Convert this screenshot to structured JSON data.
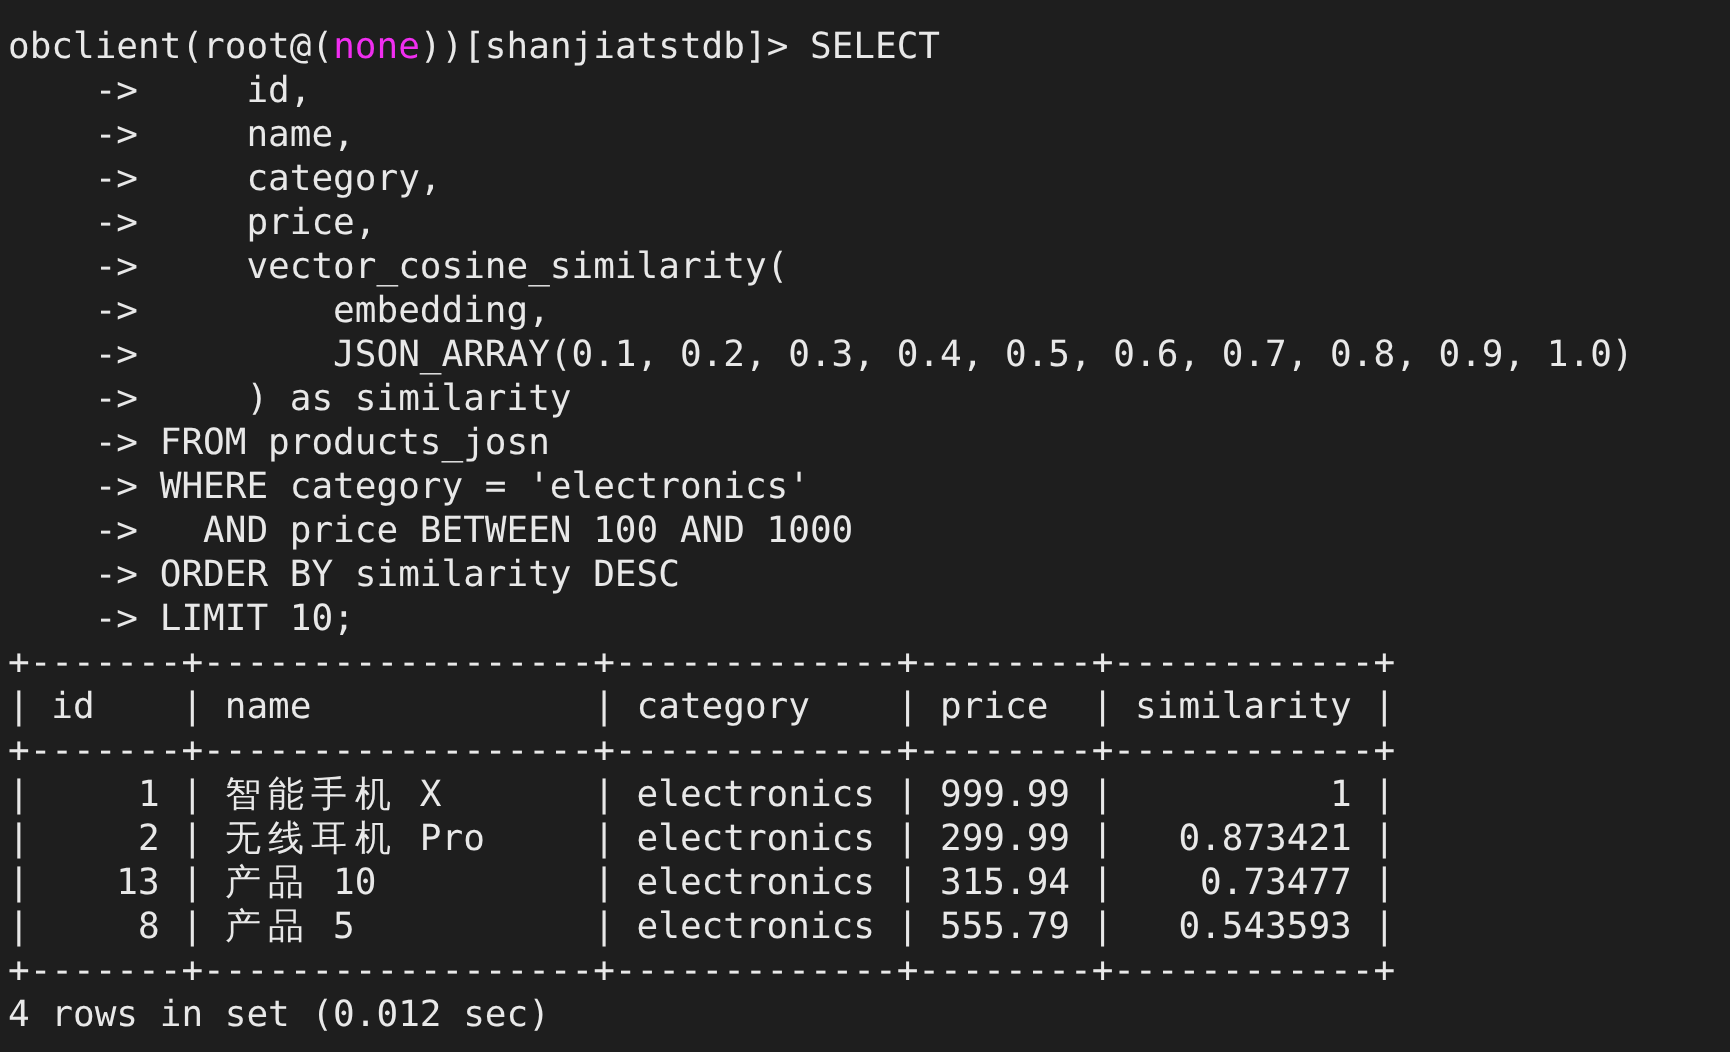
{
  "terminal": {
    "lines": [
      {
        "kind": "prompt",
        "before": "obclient(root@(",
        "database": "none",
        "after": "))[shanjiatstdb]> SELECT"
      },
      {
        "kind": "input",
        "text": "    ->     id,"
      },
      {
        "kind": "input",
        "text": "    ->     name,"
      },
      {
        "kind": "input",
        "text": "    ->     category,"
      },
      {
        "kind": "input",
        "text": "    ->     price,"
      },
      {
        "kind": "input",
        "text": "    ->     vector_cosine_similarity("
      },
      {
        "kind": "input",
        "text": "    ->         embedding,"
      },
      {
        "kind": "input",
        "text": "    ->         JSON_ARRAY(0.1, 0.2, 0.3, 0.4, 0.5, 0.6, 0.7, 0.8, 0.9, 1.0)"
      },
      {
        "kind": "input",
        "text": "    ->     ) as similarity"
      },
      {
        "kind": "input",
        "text": "    -> FROM products_josn"
      },
      {
        "kind": "input",
        "text": "    -> WHERE category = 'electronics'"
      },
      {
        "kind": "input",
        "text": "    ->   AND price BETWEEN 100 AND 1000"
      },
      {
        "kind": "input",
        "text": "    -> ORDER BY similarity DESC"
      },
      {
        "kind": "input",
        "text": "    -> LIMIT 10;"
      },
      {
        "kind": "rule",
        "text": "+-------+------------------+-------------+--------+------------+"
      },
      {
        "kind": "header",
        "text": "| id    | name             | category    | price  | similarity |"
      },
      {
        "kind": "rule",
        "text": "+-------+------------------+-------------+--------+------------+"
      },
      {
        "kind": "row",
        "text": "|     1 | 智能手机 X       | electronics | 999.99 |          1 |"
      },
      {
        "kind": "row",
        "text": "|     2 | 无线耳机 Pro     | electronics | 299.99 |   0.873421 |"
      },
      {
        "kind": "row",
        "text": "|    13 | 产品 10          | electronics | 315.94 |    0.73477 |"
      },
      {
        "kind": "row",
        "text": "|     8 | 产品 5           | electronics | 555.79 |   0.543593 |"
      },
      {
        "kind": "rule",
        "text": "+-------+------------------+-------------+--------+------------+"
      },
      {
        "kind": "output",
        "text": "4 rows in set (0.012 sec)"
      }
    ]
  }
}
